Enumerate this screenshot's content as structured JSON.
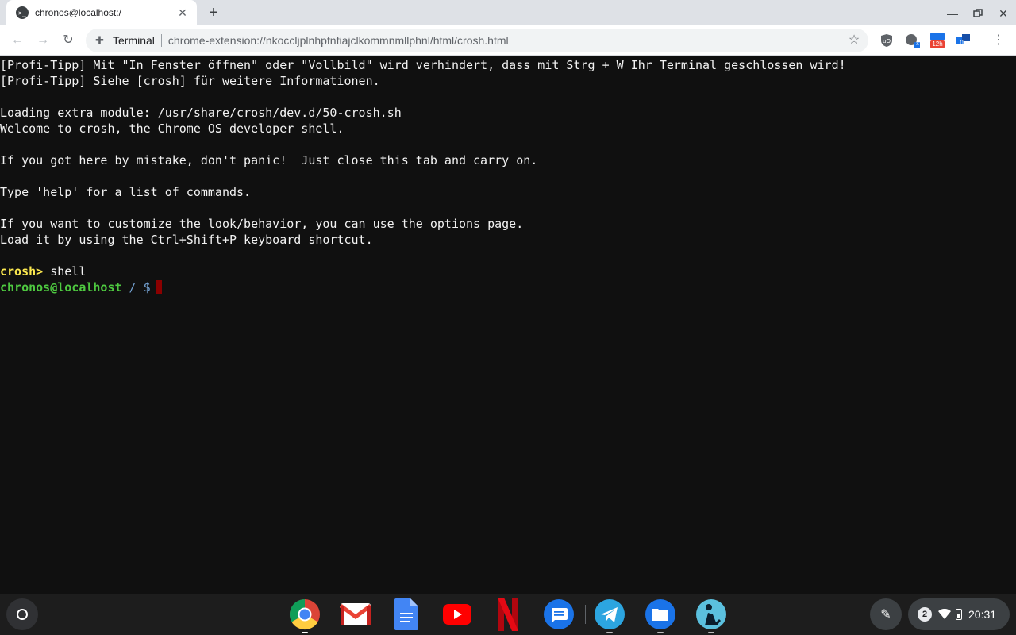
{
  "tab": {
    "title": "chronos@localhost:/",
    "favicon": ">_"
  },
  "toolbar": {
    "origin": "Terminal",
    "url": "chrome-extension://nkoccljplnhpfnfiajclkommnmllphnl/html/crosh.html"
  },
  "extensions": {
    "calendar_badge": "12h",
    "meet_badge": "x"
  },
  "terminal": {
    "lines": [
      "[Profi-Tipp] Mit \"In Fenster öffnen\" oder \"Vollbild\" wird verhindert, dass mit Strg + W Ihr Terminal geschlossen wird!",
      "[Profi-Tipp] Siehe [crosh] für weitere Informationen.",
      "",
      "Loading extra module: /usr/share/crosh/dev.d/50-crosh.sh",
      "Welcome to crosh, the Chrome OS developer shell.",
      "",
      "If you got here by mistake, don't panic!  Just close this tab and carry on.",
      "",
      "Type 'help' for a list of commands.",
      "",
      "If you want to customize the look/behavior, you can use the options page.",
      "Load it by using the Ctrl+Shift+P keyboard shortcut.",
      ""
    ],
    "crosh_prompt": "crosh>",
    "crosh_command": " shell",
    "shell_user": "chronos@localhost",
    "shell_path": " / $"
  },
  "tray": {
    "notifications": "2",
    "time": "20:31"
  },
  "colors": {
    "terminal_bg": "#101010",
    "crosh_prompt": "#fce94f",
    "shell_user": "#4ec940",
    "shell_path": "#729fcf",
    "cursor": "#8b0000"
  }
}
